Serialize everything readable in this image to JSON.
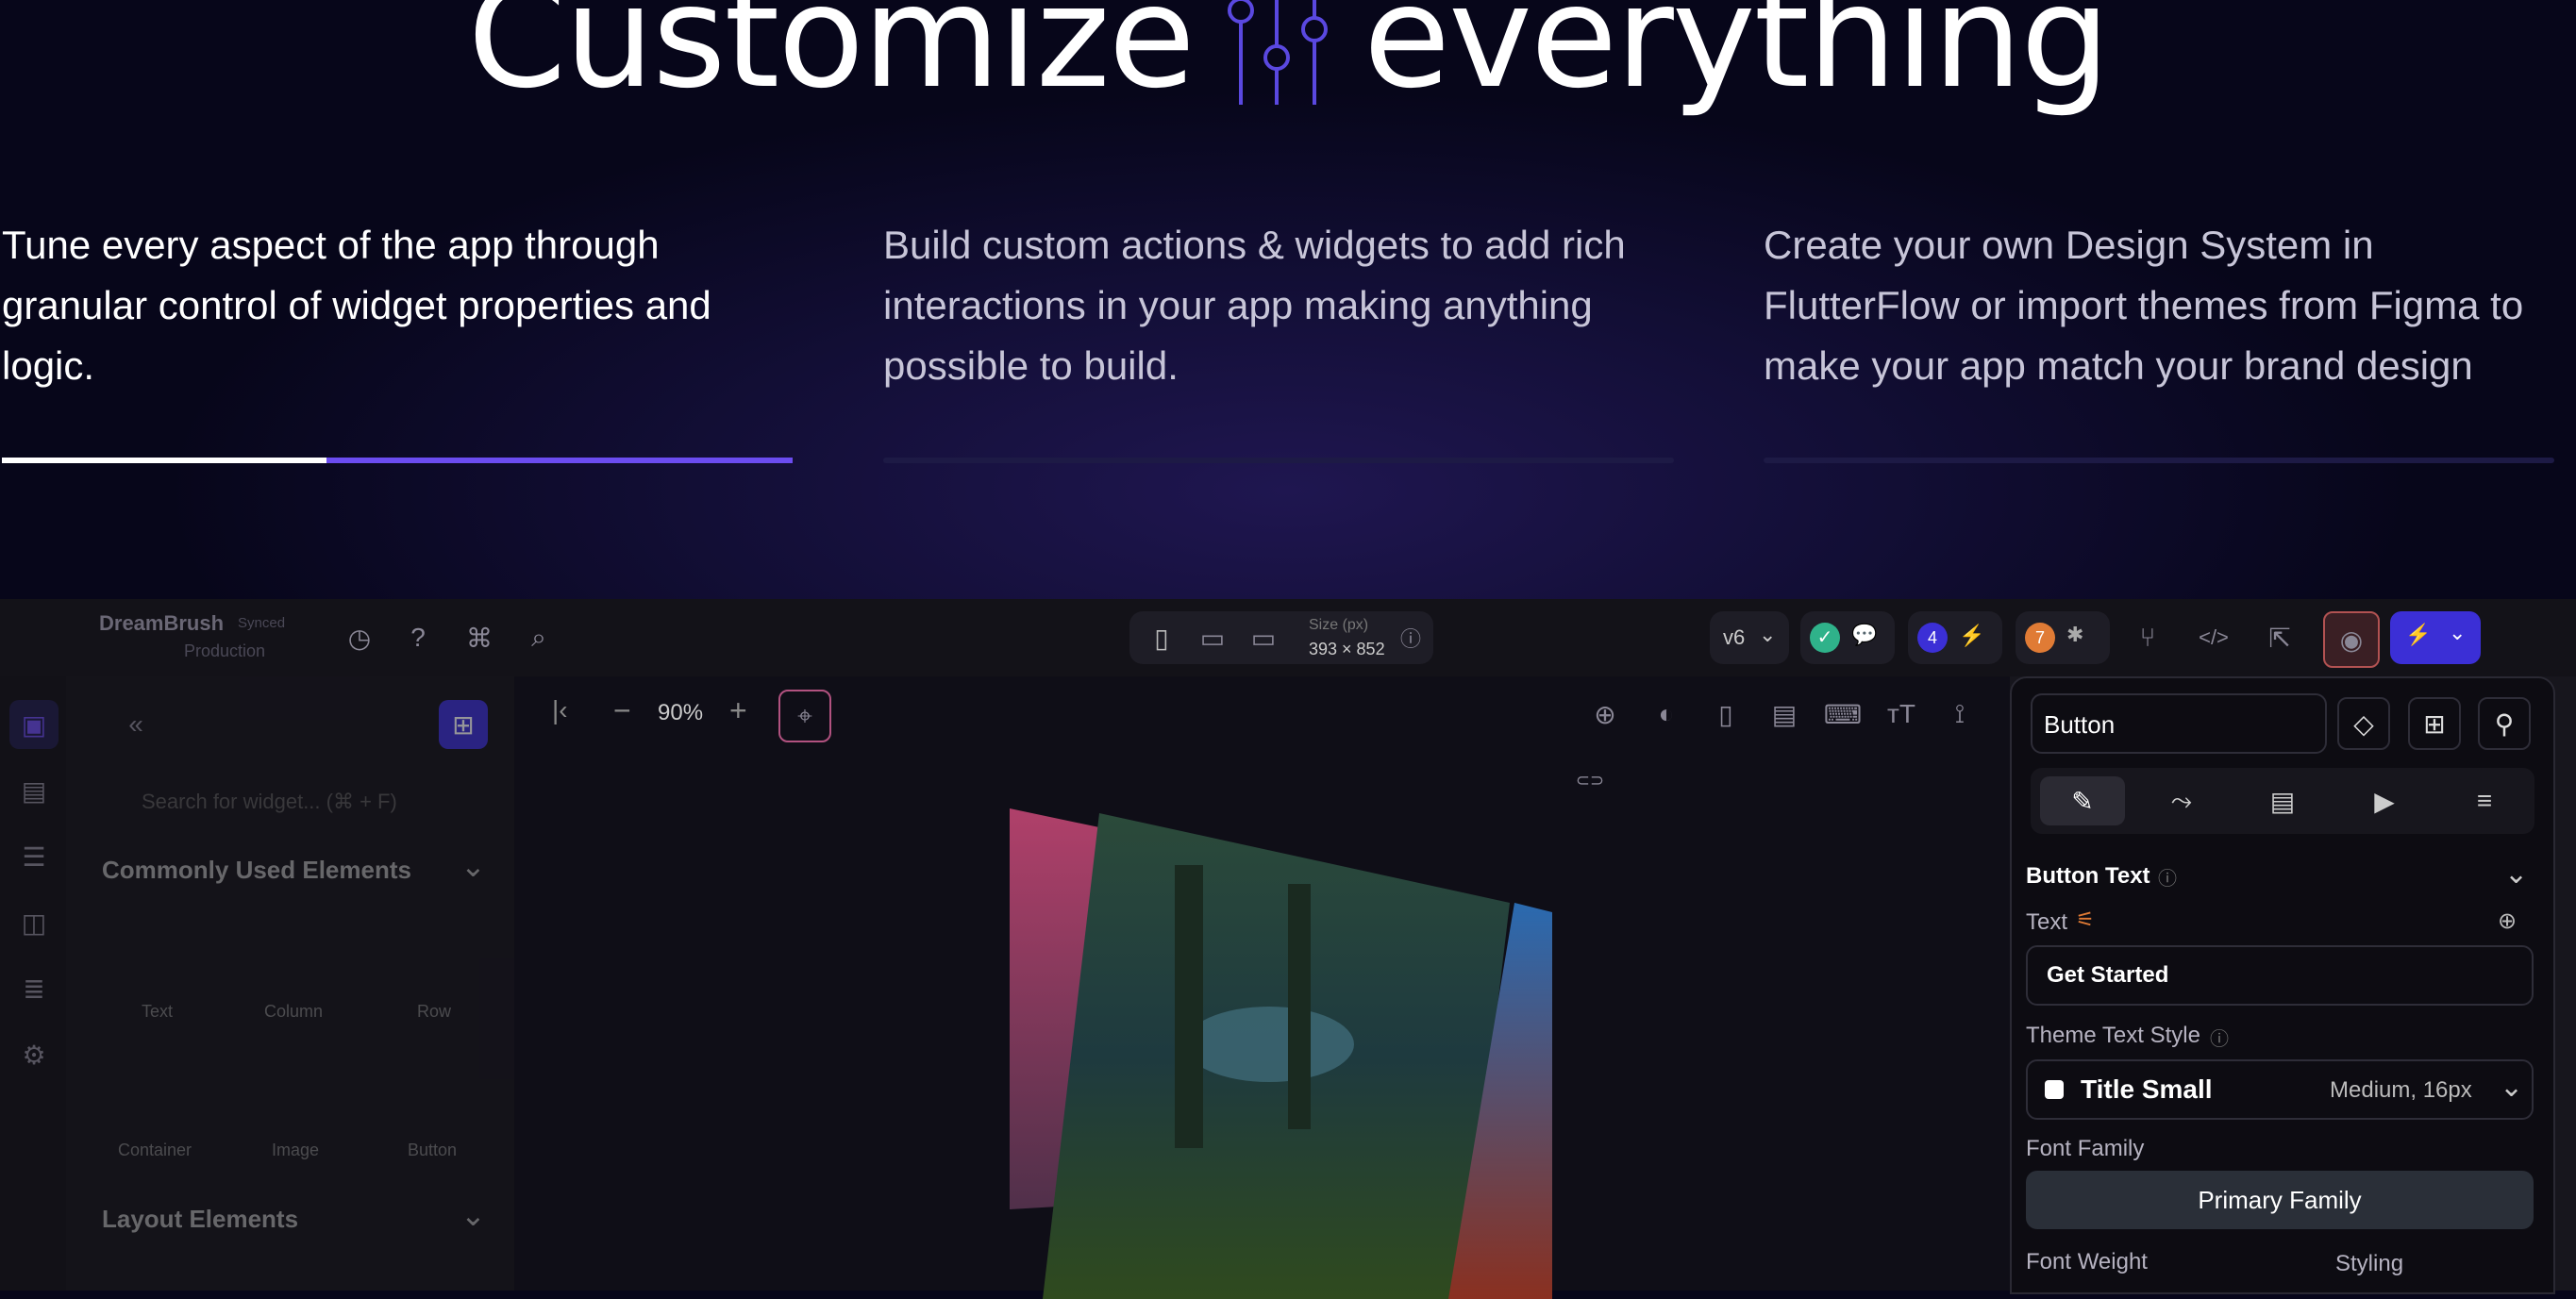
{
  "hero": {
    "headline_left": "Customize",
    "headline_right": "everything",
    "columns": [
      {
        "text": "Tune every aspect of the app through granular control of widget properties and logic."
      },
      {
        "text": "Build custom actions & widgets to add rich interactions in your app making anything possible to build."
      },
      {
        "text": "Create your own Design System in FlutterFlow or import themes from Figma to make your app match your brand design"
      }
    ],
    "progress_active": 0.41
  },
  "app": {
    "project_name": "DreamBrush",
    "project_status": "Synced",
    "branch": "Production",
    "size_label": "Size (px)",
    "size_value": "393 × 852",
    "version": "v6",
    "badge_count_blue": "4",
    "badge_count_orange": "7",
    "zoom": "90%",
    "left_panel": {
      "search_placeholder": "Search for widget... (⌘ + F)",
      "section_common": "Commonly Used Elements",
      "widgets": [
        "Text",
        "Column",
        "Row",
        "Container",
        "Image",
        "Button"
      ],
      "section_layout": "Layout Elements"
    },
    "right_panel": {
      "widget_name": "Button",
      "section_button_text": "Button Text",
      "text_label": "Text",
      "text_value": "Get Started",
      "theme_text_style_label": "Theme Text Style",
      "theme_text_style_value": "Title Small",
      "theme_text_style_meta": "Medium, 16px",
      "font_family_label": "Font Family",
      "font_family_value": "Primary Family",
      "font_weight_label": "Font Weight",
      "styling_label": "Styling"
    },
    "colors": {
      "accent": "#6b4cf0",
      "primary_button": "#3b2fd6",
      "green_check": "#2fb28a",
      "orange_badge": "#e07b35"
    }
  }
}
